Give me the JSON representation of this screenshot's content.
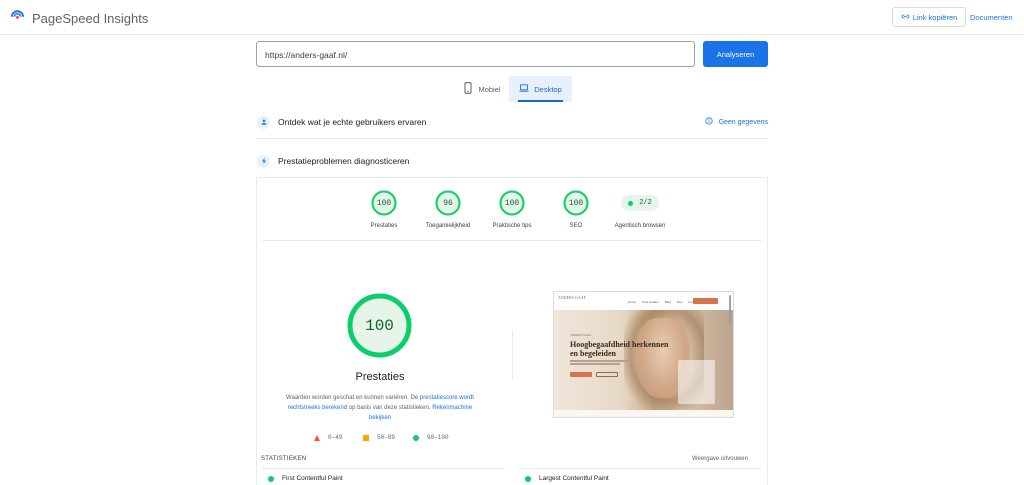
{
  "header": {
    "app_title": "PageSpeed Insights",
    "copy_link": "Link kopiëren",
    "docs": "Documenten"
  },
  "search": {
    "url": "https://anders-gaaf.nl/",
    "analyze": "Analyseren"
  },
  "tabs": [
    {
      "label": "Mobiel",
      "active": false
    },
    {
      "label": "Desktop",
      "active": true
    }
  ],
  "sections": {
    "real_users": {
      "title": "Ontdek wat je echte gebruikers ervaren",
      "status": "Geen gegevens"
    },
    "diagnose": {
      "title": "Prestatieproblemen diagnosticeren"
    }
  },
  "scores": [
    {
      "value": "100",
      "label": "Prestaties"
    },
    {
      "value": "96",
      "label": "Toegankelijkheid"
    },
    {
      "value": "100",
      "label": "Praktische tips"
    },
    {
      "value": "100",
      "label": "SEO"
    }
  ],
  "agentic": {
    "value": "2/2",
    "label": "Agentisch browsen"
  },
  "performance": {
    "score": "100",
    "title": "Prestaties",
    "note_prefix": "Waarden worden geschat en kunnen variëren. De ",
    "note_link1": "prestatiescore wordt rechtstreeks berekend",
    "note_mid": " op basis van deze statistieken. ",
    "note_link2": "Rekenmachine bekijken"
  },
  "legend": [
    {
      "range": "0–49",
      "shape": "triangle",
      "color": "#ff4e42"
    },
    {
      "range": "50–89",
      "shape": "square",
      "color": "#ffa400"
    },
    {
      "range": "90–100",
      "shape": "circle",
      "color": "#0cce6b"
    }
  ],
  "screenshot": {
    "logo": "ANDERS GAAF",
    "nav": [
      "Home",
      "Over Anders",
      "Blog",
      "Faq",
      "Contact"
    ],
    "kicker": "ANDERS GAAF",
    "headline": "Hoogbegaafdheid herkennen en begeleiden"
  },
  "stats": {
    "label": "STATISTIEKEN",
    "expand": "Weergave uitvouwen",
    "metrics": [
      "First Contentful Paint",
      "Largest Contentful Paint"
    ]
  },
  "colors": {
    "accent": "#1a73e8",
    "good": "#0cce6b",
    "good_text": "#0d652d"
  }
}
